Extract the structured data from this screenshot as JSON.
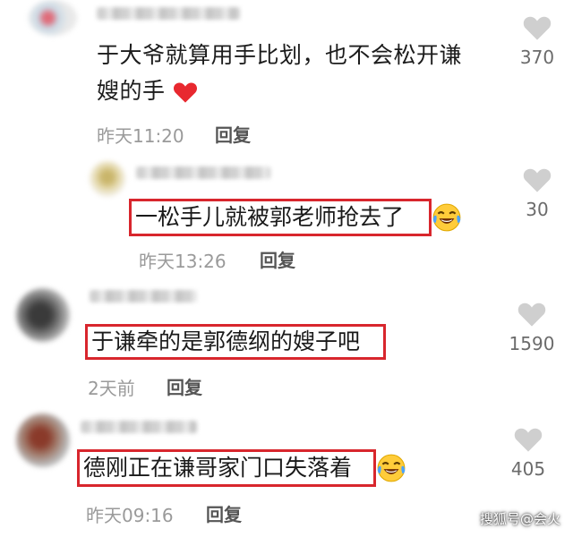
{
  "comments": [
    {
      "text_line1": "于大爷就算用手比划，也不会松开谦",
      "text_line2": "嫂的手",
      "time": "昨天11:20",
      "reply_label": "回复",
      "likes": "370"
    },
    {
      "text": "一松手儿就被郭老师抢去了",
      "time": "昨天13:26",
      "reply_label": "回复",
      "likes": "30"
    },
    {
      "text": "于谦牵的是郭德纲的嫂子吧",
      "time": "2天前",
      "reply_label": "回复",
      "likes": "1590"
    },
    {
      "text": "德刚正在谦哥家门口失落着",
      "time": "昨天09:16",
      "reply_label": "回复",
      "likes": "405"
    }
  ],
  "watermark": "搜狐号@会火",
  "colors": {
    "highlight_border": "#d8262d",
    "heart": "#cfcfcf",
    "red_heart": "#e8282f"
  },
  "icons": [
    "heart-icon",
    "red-heart-emoji",
    "laughing-crying-emoji"
  ]
}
